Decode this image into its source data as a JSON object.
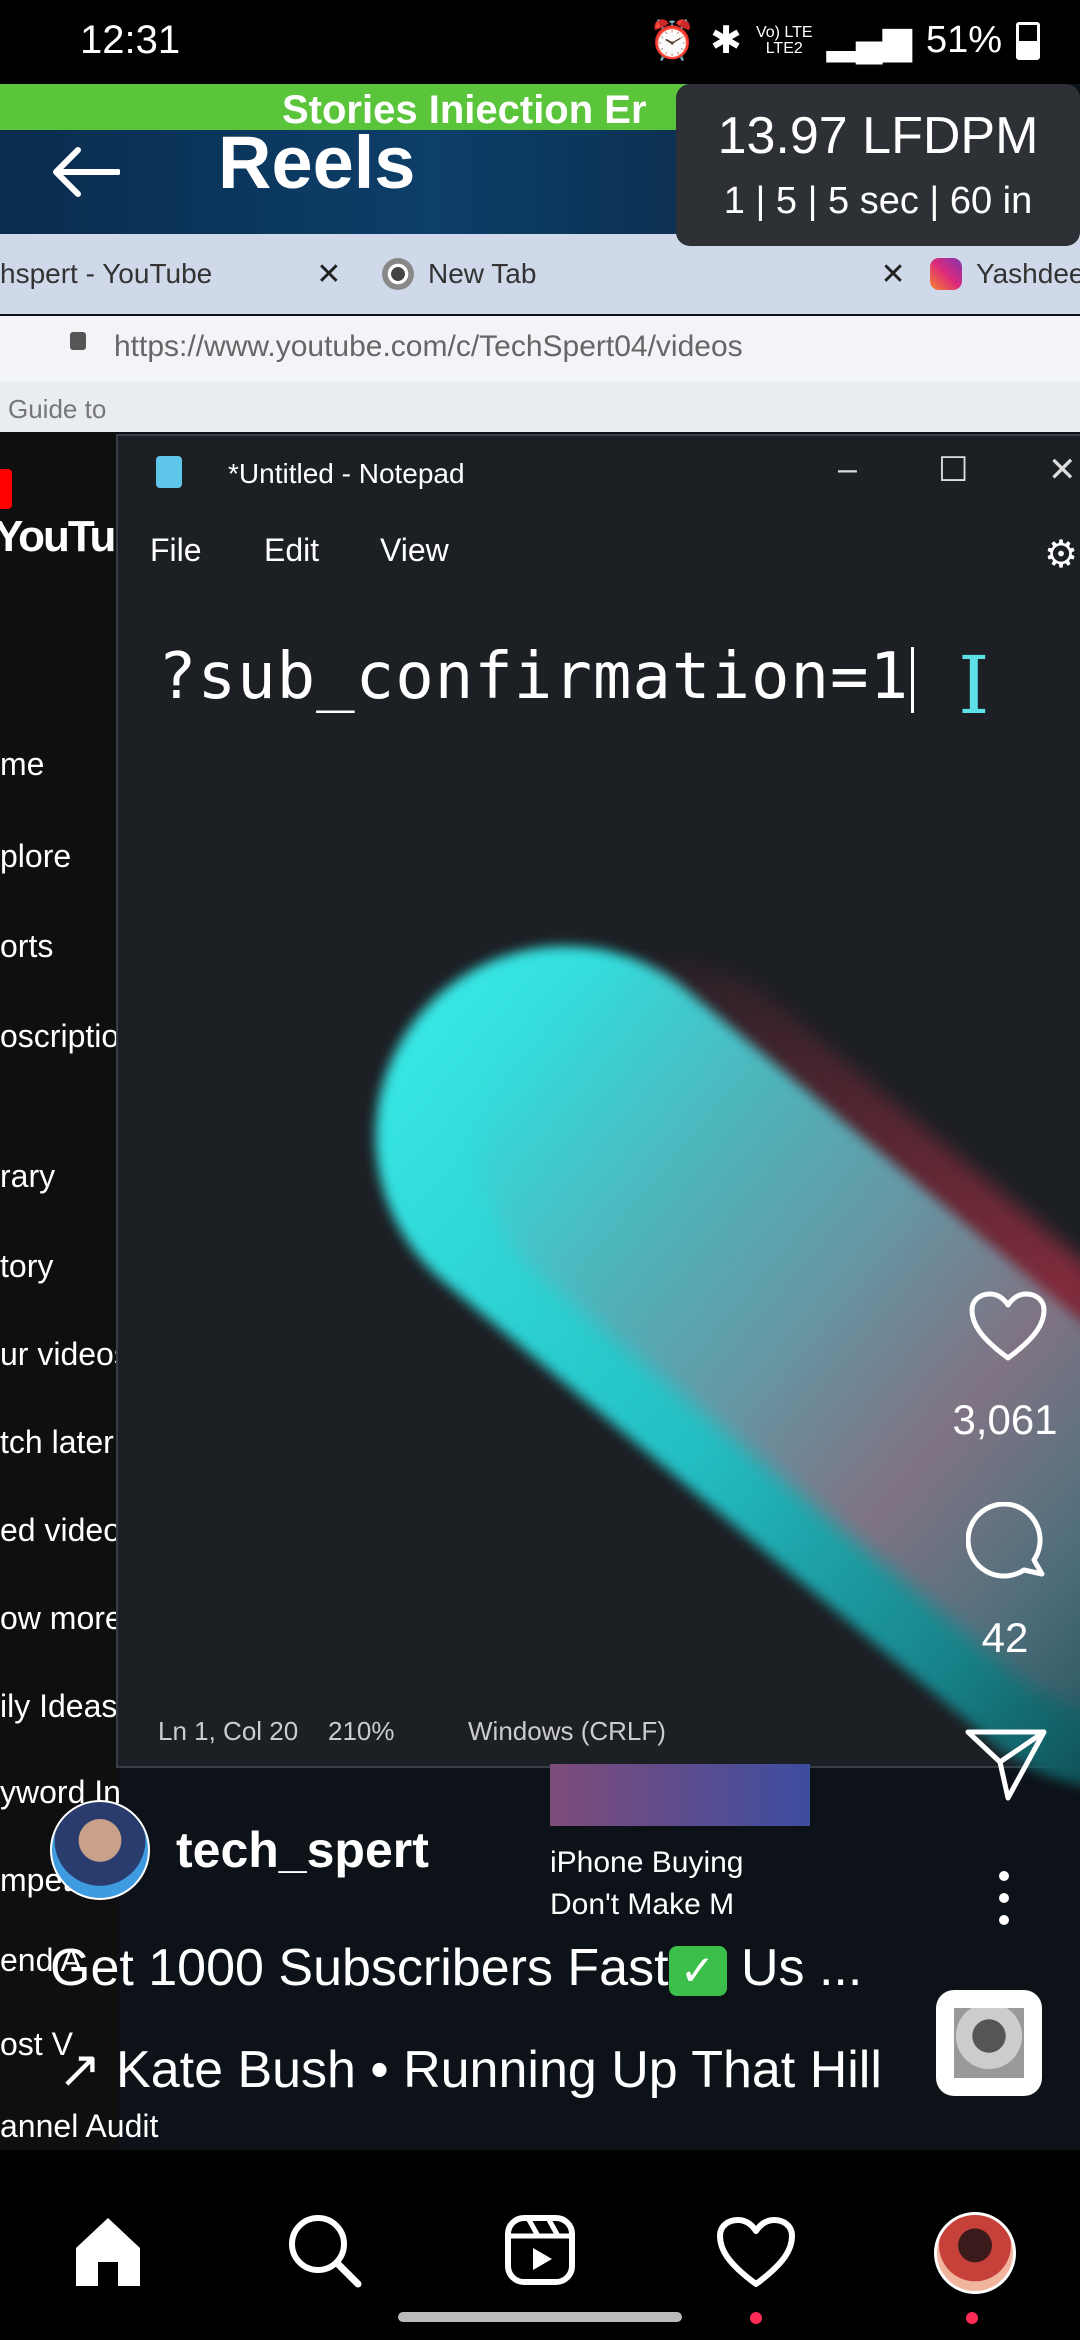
{
  "status_bar": {
    "time": "12:31",
    "network_top": "Vo) LTE",
    "network_bottom": "LTE2",
    "battery": "51%"
  },
  "video": {
    "banner_text": "Stories Iniection Er",
    "browser_tabs": [
      "hspert - YouTube",
      "New Tab",
      "Yashdee"
    ],
    "url": "https://www.youtube.com/c/TechSpert04/videos",
    "bookmarks_text": "Guide to",
    "yt_logo": "YouTu",
    "yt_side_items": [
      "me",
      "plore",
      "orts",
      "oscriptio",
      "rary",
      "tory",
      "ur videos",
      "tch later",
      "ed video",
      "ow more",
      "ily Ideas",
      "yword In",
      "mpetitors",
      "end A",
      "ost V",
      "annel Audit"
    ],
    "notepad": {
      "title": "*Untitled - Notepad",
      "menu": [
        "File",
        "Edit",
        "View"
      ],
      "text": "?sub_confirmation=1",
      "status_pos": "Ln 1, Col 20",
      "status_zoom": "210%",
      "status_eol": "Windows (CRLF)"
    },
    "thumb_card": {
      "line1": "iPhone Buying",
      "line2": "Don't Make M"
    }
  },
  "header": {
    "title": "Reels"
  },
  "stats_overlay": {
    "line1": "13.97 LFDPM",
    "line2": "1 | 5 | 5 sec | 60 in"
  },
  "actions": {
    "likes": "3,061",
    "comments": "42"
  },
  "author": {
    "username": "tech_spert"
  },
  "caption": {
    "text_before": "Get 1000 Subscribers Fast",
    "text_after": " Us ..."
  },
  "music": {
    "arrow": "↗",
    "text": "Kate Bush • Running Up That Hill"
  },
  "icons": {
    "back": "arrow-left-icon",
    "like": "heart-icon",
    "comment": "comment-icon",
    "share": "send-icon",
    "more": "more-vertical-icon"
  }
}
